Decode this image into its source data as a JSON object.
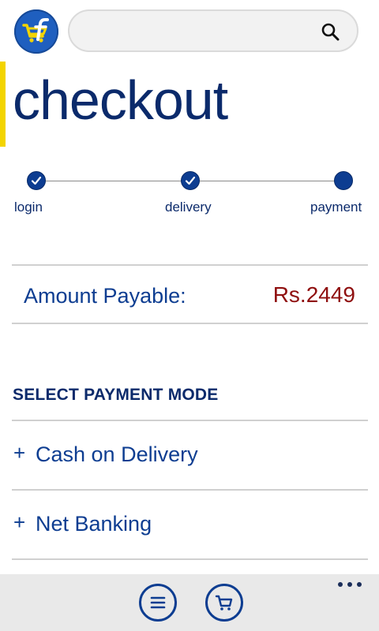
{
  "header": {
    "logo_icon": "flipkart-cart-logo",
    "search": {
      "value": "",
      "placeholder": "",
      "icon": "search-icon"
    }
  },
  "page": {
    "title": "checkout"
  },
  "steps": [
    {
      "label": "login",
      "status": "done"
    },
    {
      "label": "delivery",
      "status": "done"
    },
    {
      "label": "payment",
      "status": "current"
    }
  ],
  "amount": {
    "label": "Amount Payable:",
    "value": "Rs.2449"
  },
  "payment": {
    "heading": "SELECT PAYMENT MODE",
    "options": [
      {
        "label": "Cash on Delivery",
        "icon": "plus"
      },
      {
        "label": "Net Banking",
        "icon": "plus"
      }
    ]
  },
  "colors": {
    "brand_blue": "#0d3d91",
    "accent_yellow": "#f3d400",
    "price_red": "#8f0f0f"
  },
  "appbar": {
    "buttons": [
      {
        "icon": "menu-icon"
      },
      {
        "icon": "cart-icon"
      }
    ],
    "more_icon": "more-icon"
  }
}
